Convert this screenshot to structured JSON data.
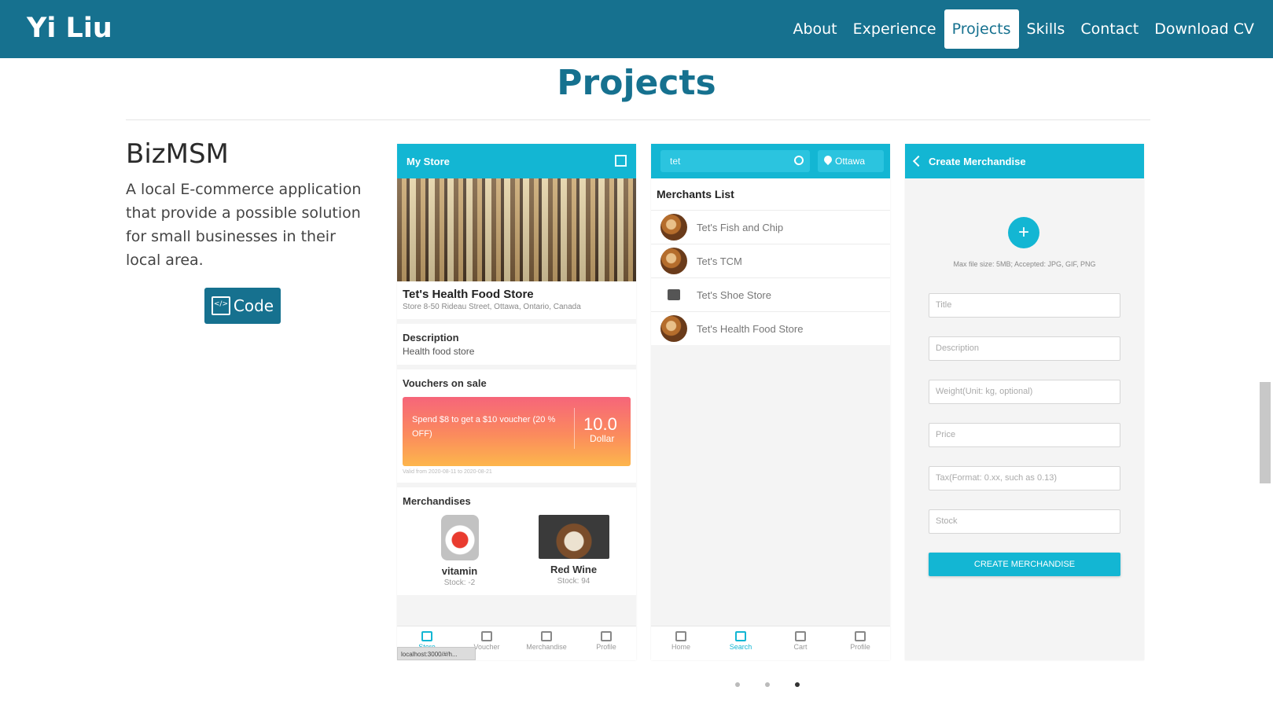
{
  "site": {
    "brand": "Yi Liu",
    "nav": [
      "About",
      "Experience",
      "Projects",
      "Skills",
      "Contact",
      "Download CV"
    ],
    "active_nav": "Projects"
  },
  "section_title": "Projects",
  "project": {
    "name": "BizMSM",
    "description": "A local E-commerce application that provide a possible solution for small businesses in their local area.",
    "code_label": "Code"
  },
  "screen1": {
    "title": "My Store",
    "store_name": "Tet's Health Food Store",
    "store_address": "Store 8-50 Rideau Street, Ottawa, Ontario, Canada",
    "description_label": "Description",
    "description_value": "Health food store",
    "vouchers_label": "Vouchers on sale",
    "voucher_text": "Spend $8 to get a $10 voucher (20 % OFF)",
    "voucher_amount": "10.0",
    "voucher_unit": "Dollar",
    "voucher_valid": "Valid from 2020-08-11 to 2020-08-21",
    "merch_label": "Merchandises",
    "merchandises": [
      {
        "name": "vitamin",
        "stock": "Stock: -2"
      },
      {
        "name": "Red Wine",
        "stock": "Stock: 94"
      }
    ],
    "bottom_nav": [
      "Store",
      "Voucher",
      "Merchandise",
      "Profile"
    ],
    "url_tip": "localhost:3000/#/h..."
  },
  "screen2": {
    "search_value": "tet",
    "location": "Ottawa",
    "list_title": "Merchants List",
    "merchants": [
      "Tet's Fish and Chip",
      "Tet's TCM",
      "Tet's Shoe Store",
      "Tet's Health Food Store"
    ],
    "bottom_nav": [
      "Home",
      "Search",
      "Cart",
      "Profile"
    ],
    "active_nav": "Search"
  },
  "screen3": {
    "title": "Create Merchandise",
    "file_hint": "Max file size: 5MB; Accepted: JPG, GIF, PNG",
    "fields": [
      "Title",
      "Description",
      "Weight(Unit: kg, optional)",
      "Price",
      "Tax(Format: 0.xx, such as 0.13)",
      "Stock"
    ],
    "submit_label": "CREATE MERCHANDISE"
  },
  "carousel": {
    "slides": 3,
    "active": 3
  },
  "colors": {
    "nav": "#16718f",
    "accent": "#13b6d3"
  }
}
